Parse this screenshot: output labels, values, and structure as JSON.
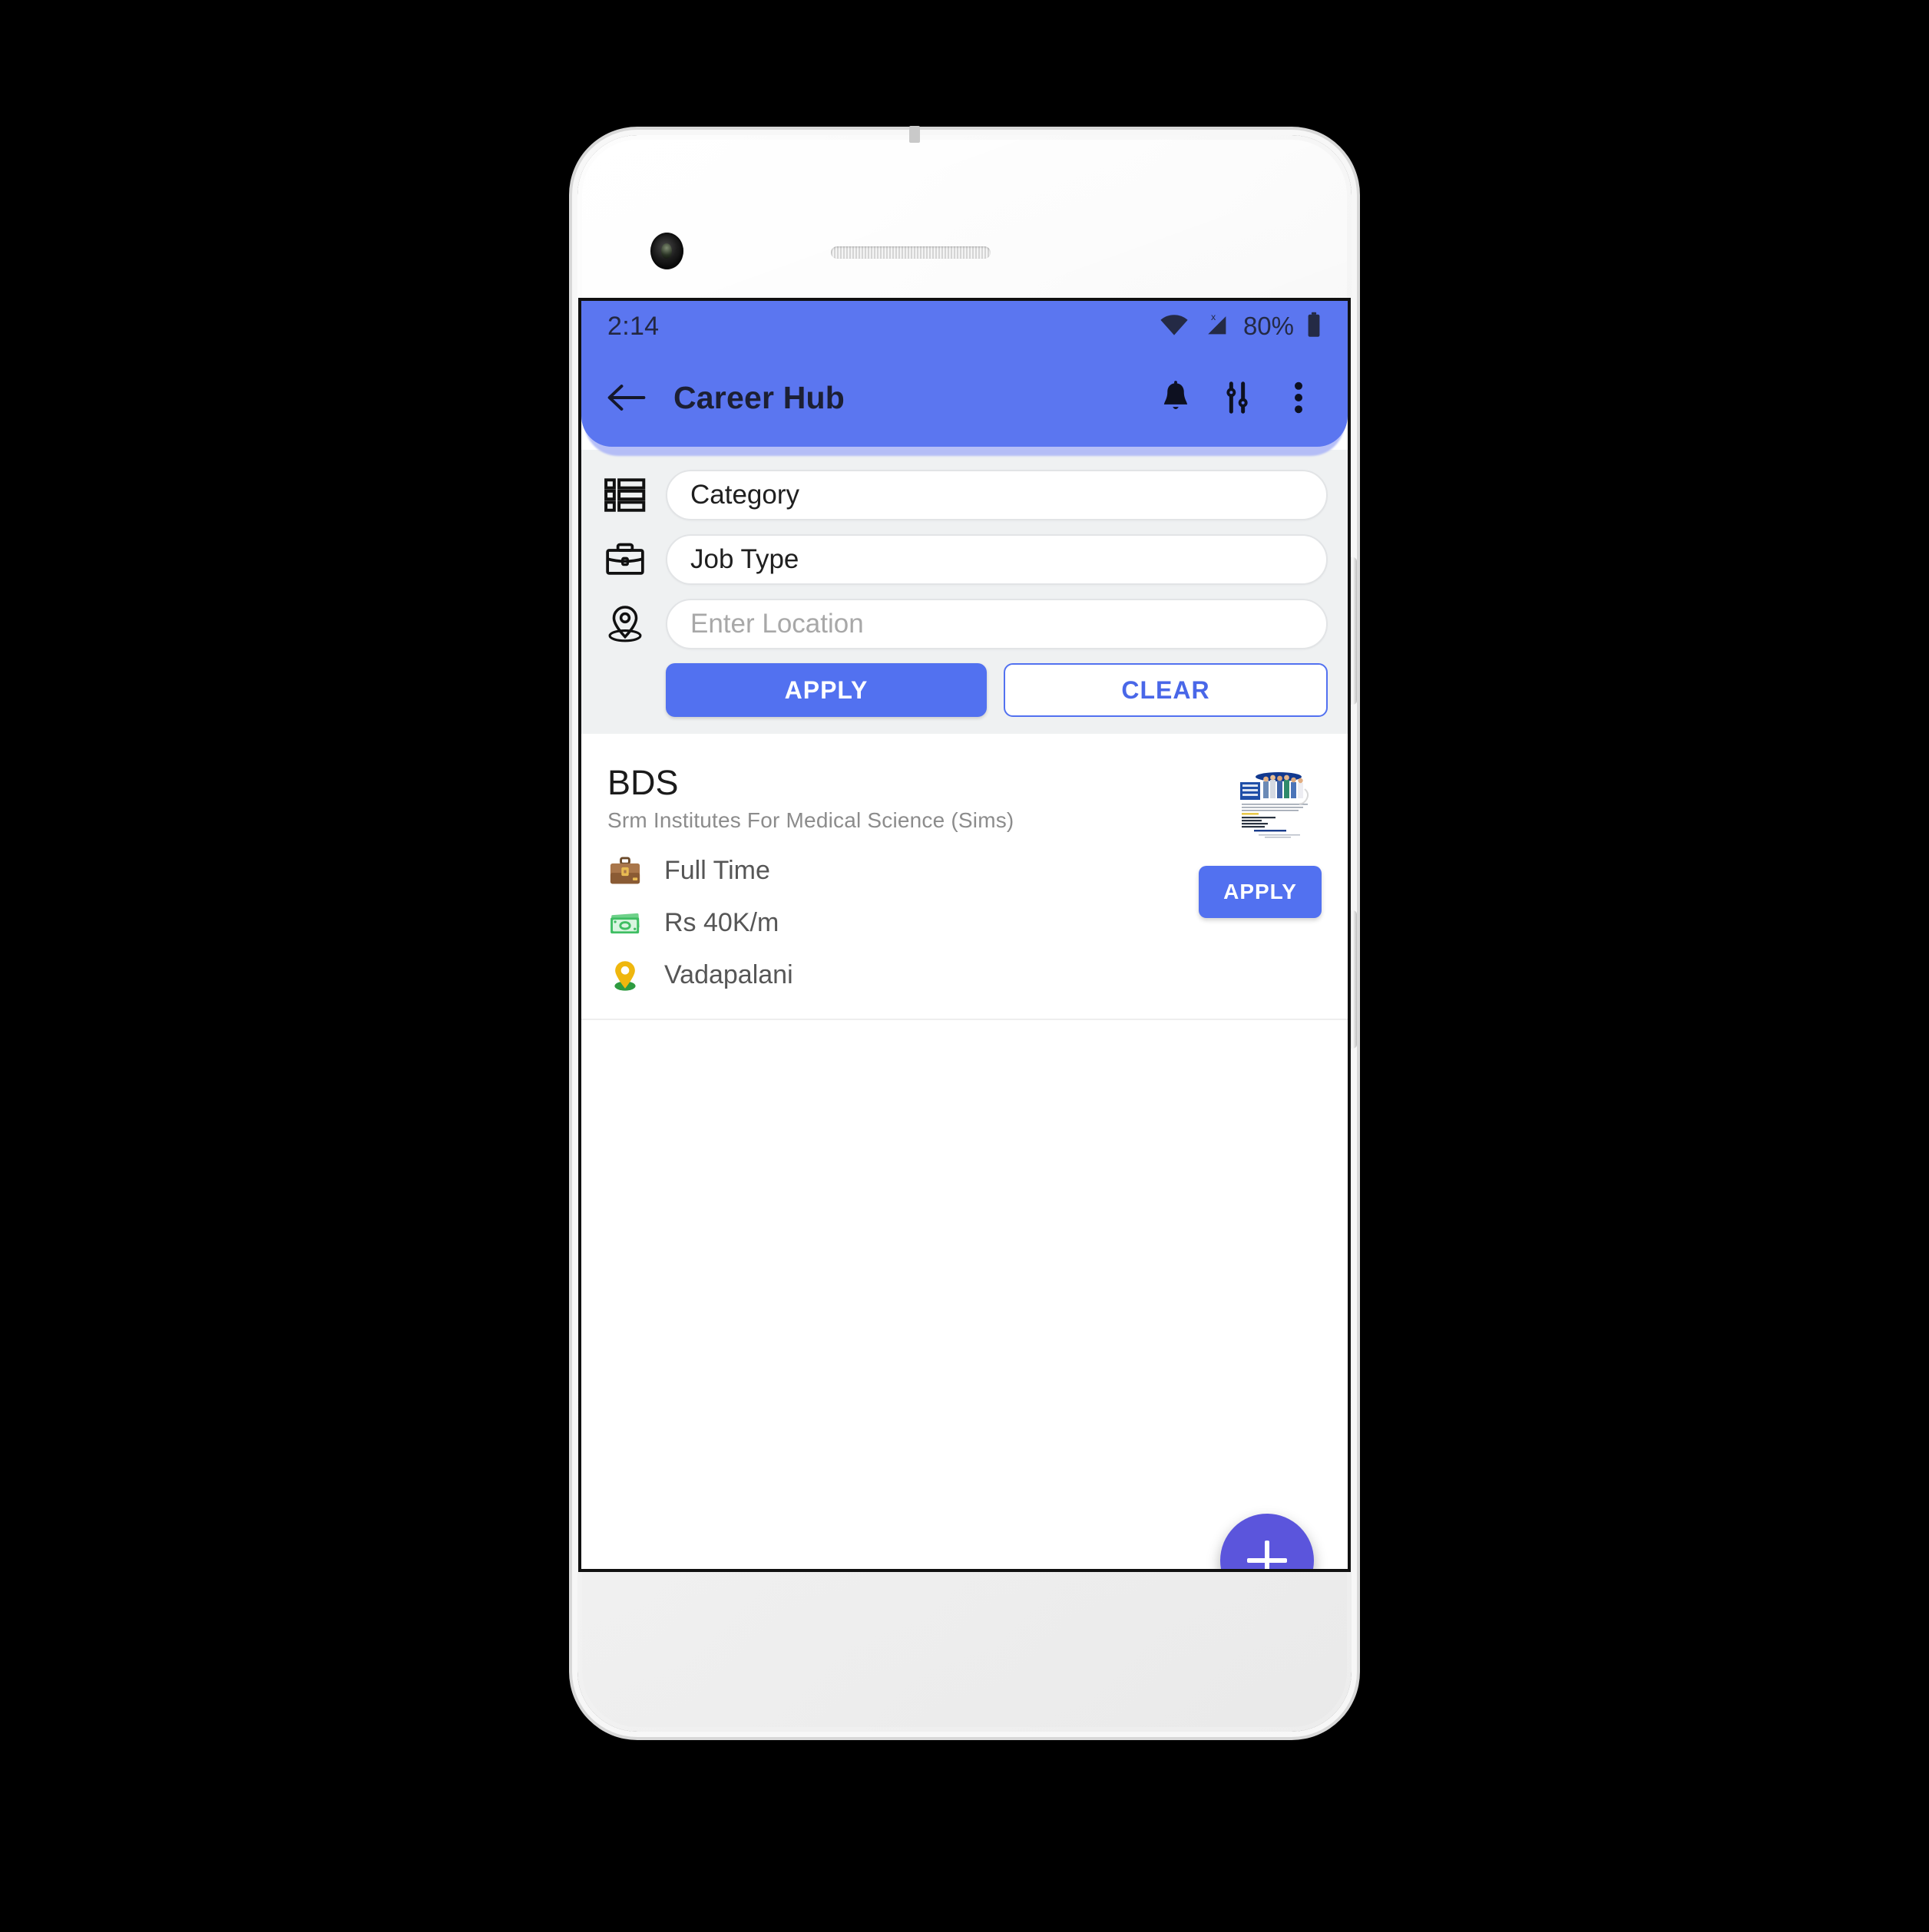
{
  "status_bar": {
    "time": "2:14",
    "battery_percent": "80%",
    "wifi_icon": "wifi-icon",
    "cellular_icon": "cellular-no-signal-icon",
    "battery_icon": "battery-icon"
  },
  "app_bar": {
    "back_icon": "arrow-left-icon",
    "title": "Career Hub",
    "notification_icon": "bell-icon",
    "filter_icon": "tune-sliders-icon",
    "overflow_icon": "more-vertical-icon",
    "brand_color": "#5b76f0"
  },
  "filters": {
    "rows": [
      {
        "icon": "list-icon",
        "value": "Category",
        "is_placeholder": false
      },
      {
        "icon": "briefcase-icon",
        "value": "Job Type",
        "is_placeholder": false
      },
      {
        "icon": "location-pin-icon",
        "value": "Enter Location",
        "is_placeholder": true
      }
    ],
    "apply_label": "APPLY",
    "clear_label": "CLEAR",
    "apply_color": "#5271f0",
    "clear_text_color": "#4967e8"
  },
  "jobs": [
    {
      "title": "BDS",
      "company": "Srm Institutes For Medical Science (Sims)",
      "meta": [
        {
          "icon": "briefcase-emoji",
          "text": "Full Time"
        },
        {
          "icon": "money-emoji",
          "text": "Rs 40K/m"
        },
        {
          "icon": "location-pin-emoji",
          "text": "Vadapalani"
        }
      ],
      "apply_label": "APPLY",
      "thumbnail": "job-poster-thumbnail"
    }
  ],
  "fab": {
    "icon": "plus-icon",
    "color": "#5b55dc"
  }
}
